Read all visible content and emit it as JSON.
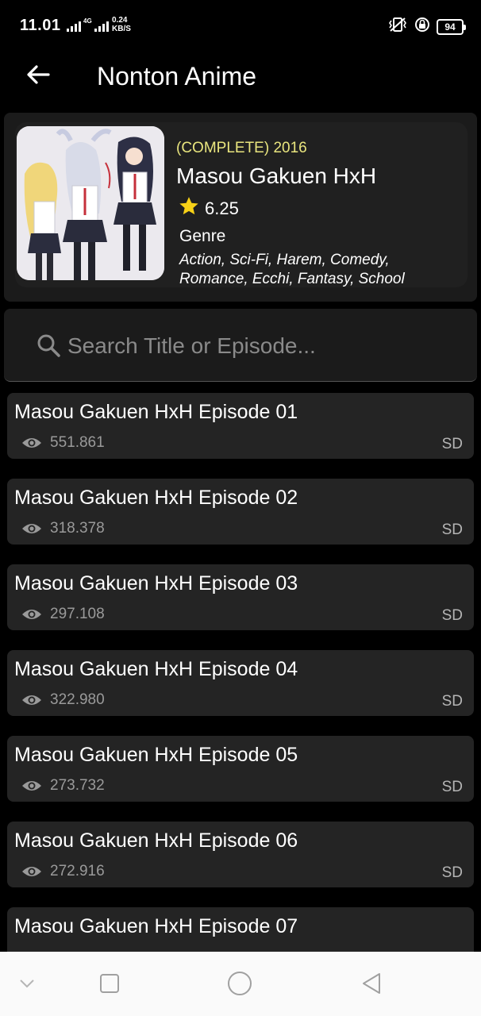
{
  "status_bar": {
    "time": "11.01",
    "network_type": "4G",
    "net_speed_value": "0.24",
    "net_speed_unit": "KB/S",
    "battery_level": "94",
    "icons": [
      "signal-icon",
      "vibrate-icon",
      "alarm-icon",
      "battery-icon"
    ]
  },
  "app_bar": {
    "title": "Nonton Anime",
    "back_icon": "arrow-left-icon"
  },
  "anime": {
    "status": "(COMPLETE) 2016",
    "title": "Masou Gakuen HxH",
    "rating": "6.25",
    "rating_icon": "star-icon",
    "genre_label": "Genre",
    "genres": "Action, Sci-Fi, Harem, Comedy, Romance, Ecchi, Fantasy, School"
  },
  "search": {
    "placeholder": "Search Title or Episode...",
    "value": ""
  },
  "episodes": [
    {
      "title": "Masou Gakuen HxH Episode 01",
      "views": "551.861",
      "quality": "SD"
    },
    {
      "title": "Masou Gakuen HxH Episode 02",
      "views": "318.378",
      "quality": "SD"
    },
    {
      "title": "Masou Gakuen HxH Episode 03",
      "views": "297.108",
      "quality": "SD"
    },
    {
      "title": "Masou Gakuen HxH Episode 04",
      "views": "322.980",
      "quality": "SD"
    },
    {
      "title": "Masou Gakuen HxH Episode 05",
      "views": "273.732",
      "quality": "SD"
    },
    {
      "title": "Masou Gakuen HxH Episode 06",
      "views": "272.916",
      "quality": "SD"
    },
    {
      "title": "Masou Gakuen HxH Episode 07",
      "views": "",
      "quality": ""
    }
  ],
  "nav_bar": {
    "items": [
      "chevron-down-icon",
      "recents-square-icon",
      "home-circle-icon",
      "back-triangle-icon"
    ]
  },
  "colors": {
    "background": "#000000",
    "card": "#242424",
    "status_accent": "#e9e57e",
    "star": "#f7d117",
    "muted_text": "#9a9a9a"
  }
}
